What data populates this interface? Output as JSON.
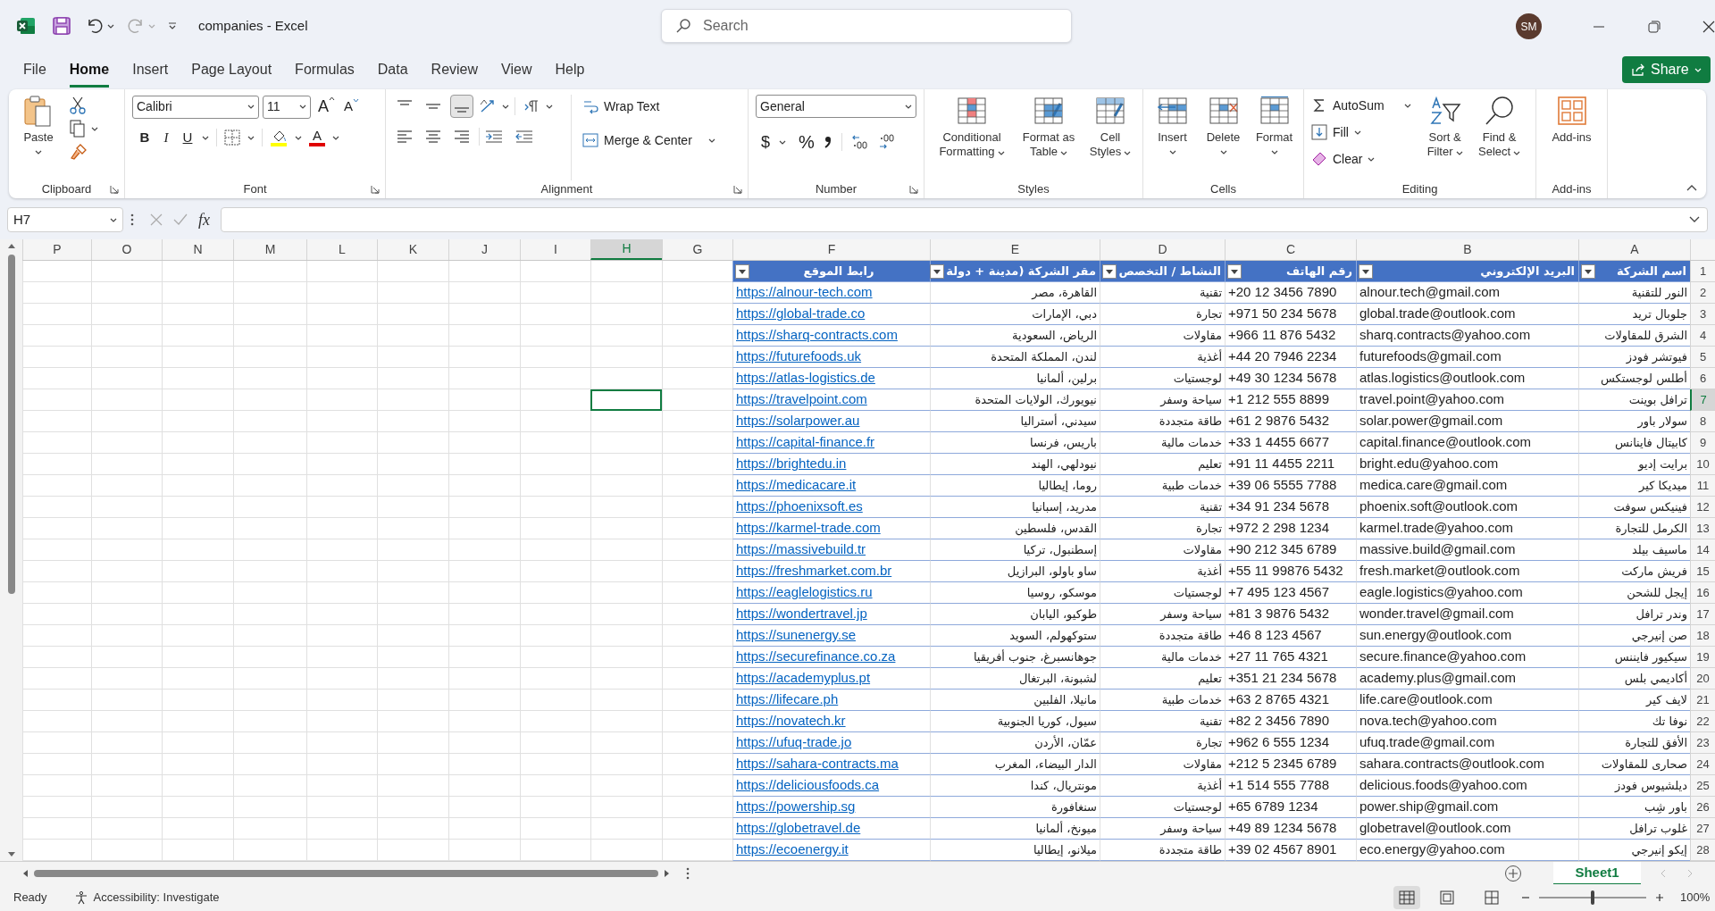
{
  "title_bar": {
    "title": "companies  -  Excel",
    "search_placeholder": "Search",
    "avatar": "SM"
  },
  "menu_tabs": {
    "file": {
      "label": "File",
      "selected": false
    },
    "home": {
      "label": "Home",
      "selected": true
    },
    "insert": {
      "label": "Insert",
      "selected": false
    },
    "page_layout": {
      "label": "Page Layout",
      "selected": false
    },
    "formulas": {
      "label": "Formulas",
      "selected": false
    },
    "data": {
      "label": "Data",
      "selected": false
    },
    "review": {
      "label": "Review",
      "selected": false
    },
    "view": {
      "label": "View",
      "selected": false
    },
    "help": {
      "label": "Help",
      "selected": false
    }
  },
  "share_button": "Share",
  "ribbon": {
    "clipboard": {
      "paste": "Paste",
      "label": "Clipboard"
    },
    "font": {
      "font_name": "Calibri",
      "font_size": "11",
      "grow_font": "A",
      "shrink_font": "A",
      "bold": "B",
      "italic": "I",
      "underline": "U",
      "font_color": "A",
      "label": "Font"
    },
    "alignment": {
      "wrap_text": "Wrap Text",
      "merge": "Merge & Center",
      "label": "Alignment"
    },
    "number": {
      "format": "General",
      "currency": "$",
      "percent": "%",
      "label": "Number"
    },
    "styles": {
      "buttons": {
        "conditional_formatting": "Conditional Formatting",
        "format_as_table": "Format as Table",
        "cell_styles": "Cell Styles"
      },
      "label": "Styles"
    },
    "cells": {
      "buttons": {
        "insert": "Insert",
        "delete": "Delete",
        "format": "Format"
      },
      "label": "Cells"
    },
    "editing": {
      "autosum": "AutoSum",
      "fill": "Fill",
      "clear": "Clear",
      "sort": "Sort & Filter",
      "find": "Find & Select",
      "label": "Editing"
    },
    "addins": {
      "button": "Add-ins",
      "label": "Add-ins"
    }
  },
  "formula_bar": {
    "name_box": "H7",
    "fx": "fx"
  },
  "sheet": {
    "column_headers": [
      {
        "label": "A",
        "selected": false
      },
      {
        "label": "B",
        "selected": false
      },
      {
        "label": "C",
        "selected": false
      },
      {
        "label": "D",
        "selected": false
      },
      {
        "label": "E",
        "selected": false
      },
      {
        "label": "F",
        "selected": false
      },
      {
        "label": "G",
        "selected": false
      },
      {
        "label": "H",
        "selected": true
      },
      {
        "label": "I",
        "selected": false
      },
      {
        "label": "J",
        "selected": false
      },
      {
        "label": "K",
        "selected": false
      },
      {
        "label": "L",
        "selected": false
      },
      {
        "label": "M",
        "selected": false
      },
      {
        "label": "N",
        "selected": false
      },
      {
        "label": "O",
        "selected": false
      },
      {
        "label": "P",
        "selected": false
      }
    ],
    "table": {
      "header_row_number": "1",
      "columns": [
        {
          "label": "اسم الشركة",
          "kind": "arabic"
        },
        {
          "label": "البريد الإلكتروني",
          "kind": "text"
        },
        {
          "label": "رقم الهاتف",
          "kind": "text"
        },
        {
          "label": "النشاط / التخصص",
          "kind": "arabic"
        },
        {
          "label": "مقر الشركة (مدينة + دولة",
          "kind": "arabic"
        },
        {
          "label": "رابط الموقع",
          "kind": "link"
        }
      ],
      "rows": [
        {
          "number": "2",
          "selected": false,
          "cells": [
            "النور للتقنية",
            "alnour.tech@gmail.com",
            "+20 12 3456 7890",
            "تقنية",
            "القاهرة، مصر",
            "https://alnour-tech.com"
          ]
        },
        {
          "number": "3",
          "selected": false,
          "cells": [
            "جلوبال تريد",
            "global.trade@outlook.com",
            "+971 50 234 5678",
            "تجارة",
            "دبي، الإمارات",
            "https://global-trade.co"
          ]
        },
        {
          "number": "4",
          "selected": false,
          "cells": [
            "الشرق للمقاولات",
            "sharq.contracts@yahoo.com",
            "+966 11 876 5432",
            "مقاولات",
            "الرياض، السعودية",
            "https://sharq-contracts.com"
          ]
        },
        {
          "number": "5",
          "selected": false,
          "cells": [
            "فيوتشر فودز",
            "futurefoods@gmail.com",
            "+44 20 7946 2234",
            "أغذية",
            "لندن، المملكة المتحدة",
            "https://futurefoods.uk"
          ]
        },
        {
          "number": "6",
          "selected": false,
          "cells": [
            "أطلس لوجستكس",
            "atlas.logistics@outlook.com",
            "+49 30 1234 5678",
            "لوجستيات",
            "برلين، ألمانيا",
            "https://atlas-logistics.de"
          ]
        },
        {
          "number": "7",
          "selected": true,
          "cells": [
            "ترافل بوينت",
            "travel.point@yahoo.com",
            "+1 212 555 8899",
            "سياحة وسفر",
            "نيويورك، الولايات المتحدة",
            "https://travelpoint.com"
          ]
        },
        {
          "number": "8",
          "selected": false,
          "cells": [
            "سولار باور",
            "solar.power@gmail.com",
            "+61 2 9876 5432",
            "طاقة متجددة",
            "سيدني، أستراليا",
            "https://solarpower.au"
          ]
        },
        {
          "number": "9",
          "selected": false,
          "cells": [
            "كابيتال فاينانس",
            "capital.finance@outlook.com",
            "+33 1 4455 6677",
            "خدمات مالية",
            "باريس، فرنسا",
            "https://capital-finance.fr"
          ]
        },
        {
          "number": "10",
          "selected": false,
          "cells": [
            "برايت إديو",
            "bright.edu@yahoo.com",
            "+91 11 4455 2211",
            "تعليم",
            "نيودلهي، الهند",
            "https://brightedu.in"
          ]
        },
        {
          "number": "11",
          "selected": false,
          "cells": [
            "ميديكا كير",
            "medica.care@gmail.com",
            "+39 06 5555 7788",
            "خدمات طبية",
            "روما، إيطاليا",
            "https://medicacare.it"
          ]
        },
        {
          "number": "12",
          "selected": false,
          "cells": [
            "فينيكس سوفت",
            "phoenix.soft@outlook.com",
            "+34 91 234 5678",
            "تقنية",
            "مدريد، إسبانيا",
            "https://phoenixsoft.es"
          ]
        },
        {
          "number": "13",
          "selected": false,
          "cells": [
            "الكرمل للتجارة",
            "karmel.trade@yahoo.com",
            "+972 2 298 1234",
            "تجارة",
            "القدس، فلسطين",
            "https://karmel-trade.com"
          ]
        },
        {
          "number": "14",
          "selected": false,
          "cells": [
            "ماسيف بيلد",
            "massive.build@gmail.com",
            "+90 212 345 6789",
            "مقاولات",
            "إسطنبول، تركيا",
            "https://massivebuild.tr"
          ]
        },
        {
          "number": "15",
          "selected": false,
          "cells": [
            "فريش ماركت",
            "fresh.market@outlook.com",
            "+55 11 99876 5432",
            "أغذية",
            "ساو باولو، البرازيل",
            "https://freshmarket.com.br"
          ]
        },
        {
          "number": "16",
          "selected": false,
          "cells": [
            "إيجل للشحن",
            "eagle.logistics@yahoo.com",
            "+7 495 123 4567",
            "لوجستيات",
            "موسكو، روسيا",
            "https://eaglelogistics.ru"
          ]
        },
        {
          "number": "17",
          "selected": false,
          "cells": [
            "وندر ترافل",
            "wonder.travel@gmail.com",
            "+81 3 9876 5432",
            "سياحة وسفر",
            "طوكيو، اليابان",
            "https://wondertravel.jp"
          ]
        },
        {
          "number": "18",
          "selected": false,
          "cells": [
            "صن إنيرجي",
            "sun.energy@outlook.com",
            "+46 8 123 4567",
            "طاقة متجددة",
            "ستوكهولم، السويد",
            "https://sunenergy.se"
          ]
        },
        {
          "number": "19",
          "selected": false,
          "cells": [
            "سيكيور فايننس",
            "secure.finance@yahoo.com",
            "+27 11 765 4321",
            "خدمات مالية",
            "جوهانسبرغ، جنوب أفريقيا",
            "https://securefinance.co.za"
          ]
        },
        {
          "number": "20",
          "selected": false,
          "cells": [
            "أكاديمي بلس",
            "academy.plus@gmail.com",
            "+351 21 234 5678",
            "تعليم",
            "لشبونة، البرتغال",
            "https://academyplus.pt"
          ]
        },
        {
          "number": "21",
          "selected": false,
          "cells": [
            "لايف كير",
            "life.care@outlook.com",
            "+63 2 8765 4321",
            "خدمات طبية",
            "مانيلا، الفلبين",
            "https://lifecare.ph"
          ]
        },
        {
          "number": "22",
          "selected": false,
          "cells": [
            "نوفا تك",
            "nova.tech@yahoo.com",
            "+82 2 3456 7890",
            "تقنية",
            "سيول، كوريا الجنوبية",
            "https://novatech.kr"
          ]
        },
        {
          "number": "23",
          "selected": false,
          "cells": [
            "الأفق للتجارة",
            "ufuq.trade@gmail.com",
            "+962 6 555 1234",
            "تجارة",
            "عمّان، الأردن",
            "https://ufuq-trade.jo"
          ]
        },
        {
          "number": "24",
          "selected": false,
          "cells": [
            "صحارى للمقاولات",
            "sahara.contracts@outlook.com",
            "+212 5 2345 6789",
            "مقاولات",
            "الدار البيضاء، المغرب",
            "https://sahara-contracts.ma"
          ]
        },
        {
          "number": "25",
          "selected": false,
          "cells": [
            "ديلشيوس فودز",
            "delicious.foods@yahoo.com",
            "+1 514 555 7788",
            "أغذية",
            "مونتريال، كندا",
            "https://deliciousfoods.ca"
          ]
        },
        {
          "number": "26",
          "selected": false,
          "cells": [
            "باور شِب",
            "power.ship@gmail.com",
            "+65 6789 1234",
            "لوجستيات",
            "سنغافورة",
            "https://powership.sg"
          ]
        },
        {
          "number": "27",
          "selected": false,
          "cells": [
            "غلوب ترافل",
            "globetravel@outlook.com",
            "+49 89 1234 5678",
            "سياحة وسفر",
            "ميونخ، ألمانيا",
            "https://globetravel.de"
          ]
        },
        {
          "number": "28",
          "selected": false,
          "cells": [
            "إيكو إنيرجي",
            "eco.energy@yahoo.com",
            "+39 02 4567 8901",
            "طاقة متجددة",
            "ميلانو، إيطاليا",
            "https://ecoenergy.it"
          ]
        }
      ]
    }
  },
  "sheet_tabs": [
    {
      "label": "Sheet1",
      "selected": true
    }
  ],
  "status_bar": {
    "ready": "Ready",
    "accessibility": "Accessibility: Investigate",
    "zoom": "100%",
    "zoom_slider": {
      "level": 0.5
    }
  }
}
